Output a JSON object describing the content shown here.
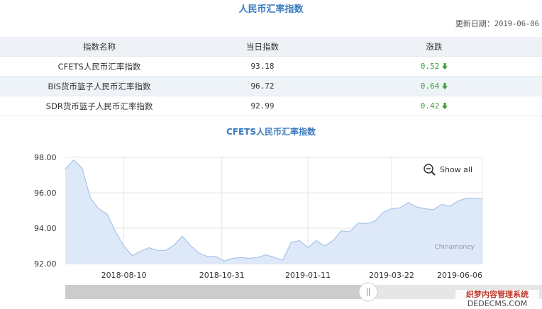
{
  "page": {
    "title": "人民币汇率指数",
    "update_label": "更新日期：",
    "update_date": "2019-06-06"
  },
  "table": {
    "headers": [
      "指数名称",
      "当日指数",
      "涨跌"
    ],
    "rows": [
      {
        "name": "CFETS人民币汇率指数",
        "value": "93.18",
        "change": "0.52"
      },
      {
        "name": "BIS货币篮子人民币汇率指数",
        "value": "96.72",
        "change": "0.64"
      },
      {
        "name": "SDR货币篮子人民币汇率指数",
        "value": "92.99",
        "change": "0.42"
      }
    ],
    "change_icon": "arrow-down-icon",
    "change_color": "#3a9a3a"
  },
  "chart": {
    "show_all_label": "Show all",
    "show_all_icon": "zoom-out-icon",
    "credit": "Chinamoney"
  },
  "chart_data": {
    "type": "area",
    "title": "CFETS人民币汇率指数",
    "xlabel": "",
    "ylabel": "",
    "ylim": [
      92,
      98
    ],
    "yticks": [
      "98.00",
      "96.00",
      "94.00",
      "92.00"
    ],
    "xticks": [
      "2018-08-10",
      "2018-10-31",
      "2019-01-11",
      "2019-03-22",
      "2019-06-06"
    ],
    "grid": true,
    "fill_color": "#dde8f8",
    "line_color": "#a8c4e8",
    "series": [
      {
        "x": [
          "2018-06-22",
          "2018-06-29",
          "2018-07-06",
          "2018-07-13",
          "2018-07-20",
          "2018-07-27",
          "2018-08-03",
          "2018-08-10",
          "2018-08-17",
          "2018-08-24",
          "2018-08-31",
          "2018-09-07",
          "2018-09-14",
          "2018-09-21",
          "2018-09-28",
          "2018-10-05",
          "2018-10-12",
          "2018-10-19",
          "2018-10-26",
          "2018-11-02",
          "2018-11-09",
          "2018-11-16",
          "2018-11-23",
          "2018-11-30",
          "2018-12-07",
          "2018-12-14",
          "2018-12-21",
          "2018-12-28",
          "2019-01-04",
          "2019-01-11",
          "2019-01-18",
          "2019-01-25",
          "2019-02-01",
          "2019-02-08",
          "2019-02-15",
          "2019-02-22",
          "2019-03-01",
          "2019-03-08",
          "2019-03-15",
          "2019-03-22",
          "2019-03-29",
          "2019-04-05",
          "2019-04-12",
          "2019-04-19",
          "2019-04-26",
          "2019-05-03",
          "2019-05-10",
          "2019-05-17",
          "2019-05-24",
          "2019-05-31",
          "2019-06-06"
        ],
        "values": [
          97.35,
          97.85,
          97.4,
          95.7,
          95.1,
          94.8,
          93.8,
          93.0,
          92.45,
          92.7,
          92.9,
          92.75,
          92.75,
          93.05,
          93.55,
          93.0,
          92.6,
          92.4,
          92.4,
          92.15,
          92.3,
          92.35,
          92.3,
          92.35,
          92.5,
          92.35,
          92.2,
          93.2,
          93.3,
          92.9,
          93.3,
          93.0,
          93.3,
          93.85,
          93.8,
          94.3,
          94.25,
          94.4,
          94.9,
          95.1,
          95.15,
          95.45,
          95.2,
          95.1,
          95.05,
          95.35,
          95.25,
          95.55,
          95.7,
          95.7,
          95.65
        ]
      }
    ]
  },
  "watermark": {
    "line1": "织梦内容管理系统",
    "line2": "DEDECMS.COM"
  }
}
